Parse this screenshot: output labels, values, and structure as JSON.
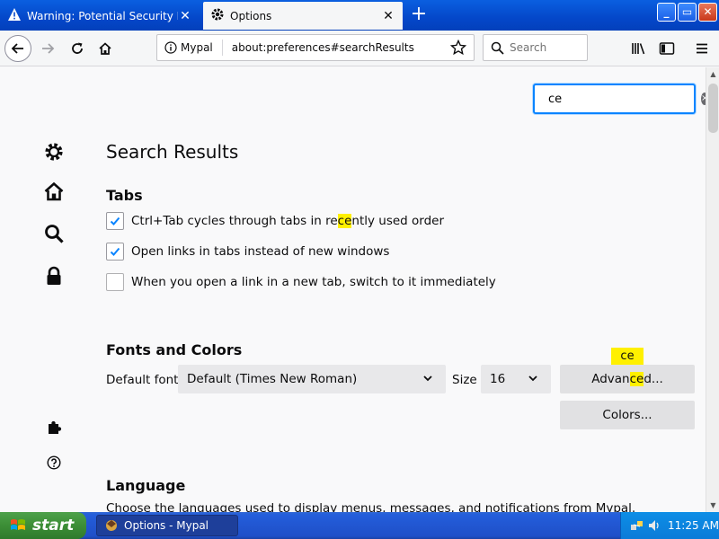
{
  "tabs": [
    {
      "title": "Warning: Potential Security Risk A",
      "icon": "warning-icon",
      "close": "✕"
    },
    {
      "title": "Options",
      "icon": "gear-icon",
      "close": "✕"
    }
  ],
  "newtab": "+",
  "window": {
    "minimize": "_",
    "maximize": "▭",
    "close": "✕"
  },
  "nav": {
    "site_label": "Mypal",
    "url": "about:preferences#searchResults",
    "search_placeholder": "Search"
  },
  "find": {
    "value": "ce",
    "clear": "×"
  },
  "page": {
    "title": "Search Results",
    "tabs_heading": "Tabs",
    "checkboxes": [
      {
        "pre": "Ctrl+Tab cycles through tabs in re",
        "hl": "ce",
        "post": "ntly used order",
        "checked": true
      },
      {
        "pre": "Open links in tabs instead of new windows",
        "hl": "",
        "post": "",
        "checked": true
      },
      {
        "pre": "When you open a link in a new tab, switch to it immediately",
        "hl": "",
        "post": "",
        "checked": false
      }
    ],
    "fonts_heading": "Fonts and Colors",
    "default_font_label": "Default font",
    "default_font_value": "Default (Times New Roman)",
    "size_label": "Size",
    "size_value": "16",
    "advanced_pre": "Advan",
    "advanced_hl": "ce",
    "advanced_post": "d...",
    "tooltip": "ce",
    "colors_button": "Colors...",
    "language_heading": "Language",
    "language_desc": "Choose the languages used to display menus, messages, and notifications from Mypal."
  },
  "taskbar": {
    "start": "start",
    "item": "Options - Mypal",
    "clock": "11:25 AM"
  },
  "colors": {
    "accent": "#0a84ff",
    "highlight": "#fff000",
    "titlebar": "#0447c9"
  }
}
